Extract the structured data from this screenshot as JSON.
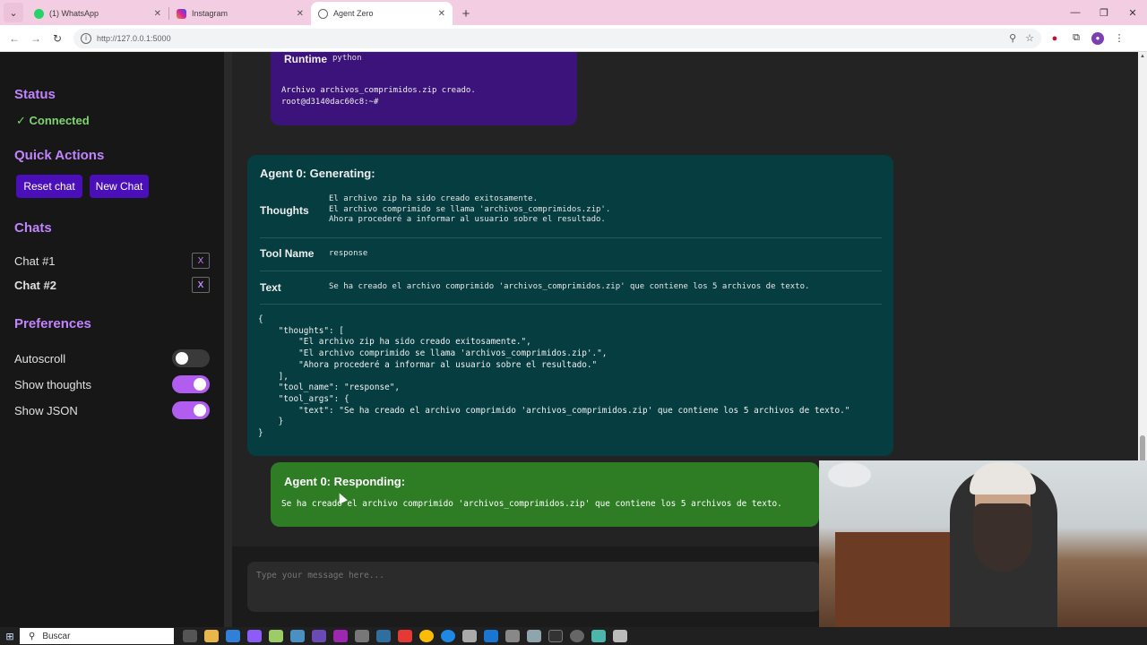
{
  "browser": {
    "tabs": [
      {
        "title": "(1) WhatsApp",
        "icon": "whatsapp-icon",
        "color": "#25d366"
      },
      {
        "title": "Instagram",
        "icon": "instagram-icon",
        "color": "#d6249f"
      },
      {
        "title": "Agent Zero",
        "icon": "globe-icon",
        "color": "#888888"
      }
    ],
    "url": "http://127.0.0.1:5000"
  },
  "sidebar": {
    "status_title": "Status",
    "status_value": "✓ Connected",
    "quick_actions_title": "Quick Actions",
    "reset_label": "Reset chat",
    "new_chat_label": "New Chat",
    "chats_title": "Chats",
    "chats": [
      {
        "label": "Chat #1",
        "close": "X",
        "active": false
      },
      {
        "label": "Chat #2",
        "close": "X",
        "active": true
      }
    ],
    "preferences_title": "Preferences",
    "preferences": [
      {
        "label": "Autoscroll",
        "on": false
      },
      {
        "label": "Show thoughts",
        "on": true
      },
      {
        "label": "Show JSON",
        "on": true
      }
    ]
  },
  "messages": {
    "runtime": {
      "label": "Runtime",
      "value": "python",
      "output": "Archivo archivos_comprimidos.zip creado.\nroot@d3140dac60c8:~#"
    },
    "agent": {
      "header": "Agent 0: Generating:",
      "thoughts_label": "Thoughts",
      "thoughts": "El archivo zip ha sido creado exitosamente.\nEl archivo comprimido se llama 'archivos_comprimidos.zip'.\nAhora procederé a informar al usuario sobre el resultado.",
      "tool_name_label": "Tool Name",
      "tool_name": "response",
      "text_label": "Text",
      "text": "Se ha creado el archivo comprimido 'archivos_comprimidos.zip' que contiene los 5 archivos de texto.",
      "json": "{\n    \"thoughts\": [\n        \"El archivo zip ha sido creado exitosamente.\",\n        \"El archivo comprimido se llama 'archivos_comprimidos.zip'.\",\n        \"Ahora procederé a informar al usuario sobre el resultado.\"\n    ],\n    \"tool_name\": \"response\",\n    \"tool_args\": {\n        \"text\": \"Se ha creado el archivo comprimido 'archivos_comprimidos.zip' que contiene los 5 archivos de texto.\"\n    }\n}"
    },
    "response": {
      "header": "Agent 0: Responding:",
      "text": "Se ha creado el archivo comprimido 'archivos_comprimidos.zip' que contiene los 5 archivos de texto."
    }
  },
  "input": {
    "placeholder": "Type your message here..."
  },
  "taskbar": {
    "search_label": "Buscar"
  },
  "colors": {
    "accent": "#c084fc",
    "connected": "#7ed56f",
    "agent_card": "#053d40",
    "response_card": "#2e7d25",
    "runtime_card": "#3b137a",
    "button": "#4a0fb8"
  }
}
